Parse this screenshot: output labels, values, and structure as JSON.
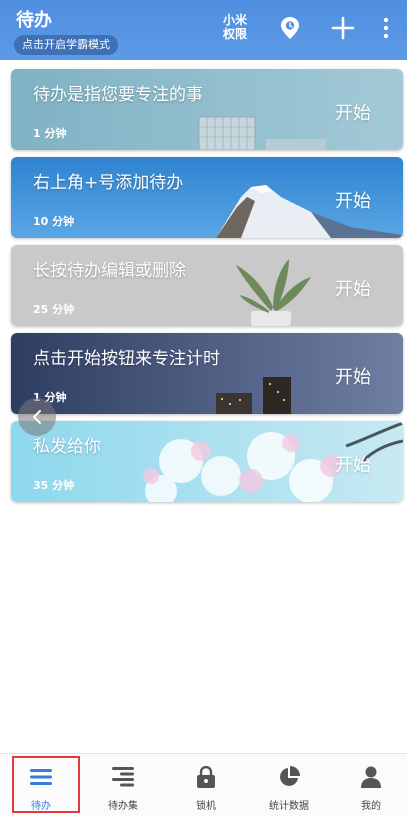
{
  "header": {
    "title": "待办",
    "mode_button": "点击开启学霸模式",
    "permission_line1": "小米",
    "permission_line2": "权限",
    "icons": [
      "location-pin-icon",
      "plus-icon",
      "more-vertical-icon"
    ]
  },
  "todos": [
    {
      "title": "待办是指您要专注的事",
      "duration": "1 分钟",
      "start": "开始",
      "theme": "city-sky"
    },
    {
      "title": "右上角+号添加待办",
      "duration": "10 分钟",
      "start": "开始",
      "theme": "snow-mountain"
    },
    {
      "title": "长按待办编辑或删除",
      "duration": "25 分钟",
      "start": "开始",
      "theme": "plant-gray"
    },
    {
      "title": "点击开始按钮来专注计时",
      "duration": "1 分钟",
      "start": "开始",
      "theme": "night-city"
    },
    {
      "title": "私发给你",
      "duration": "35 分钟",
      "start": "开始",
      "theme": "cherry-blossom"
    }
  ],
  "bottom_nav": [
    {
      "label": "待办",
      "icon": "list-icon",
      "active": true
    },
    {
      "label": "待办集",
      "icon": "stacked-list-icon",
      "active": false
    },
    {
      "label": "锁机",
      "icon": "lock-icon",
      "active": false
    },
    {
      "label": "统计数据",
      "icon": "pie-chart-icon",
      "active": false
    },
    {
      "label": "我的",
      "icon": "person-icon",
      "active": false
    }
  ],
  "colors": {
    "header": "#5493e3",
    "accent": "#3b7bd6",
    "highlight": "#e23a3a"
  }
}
